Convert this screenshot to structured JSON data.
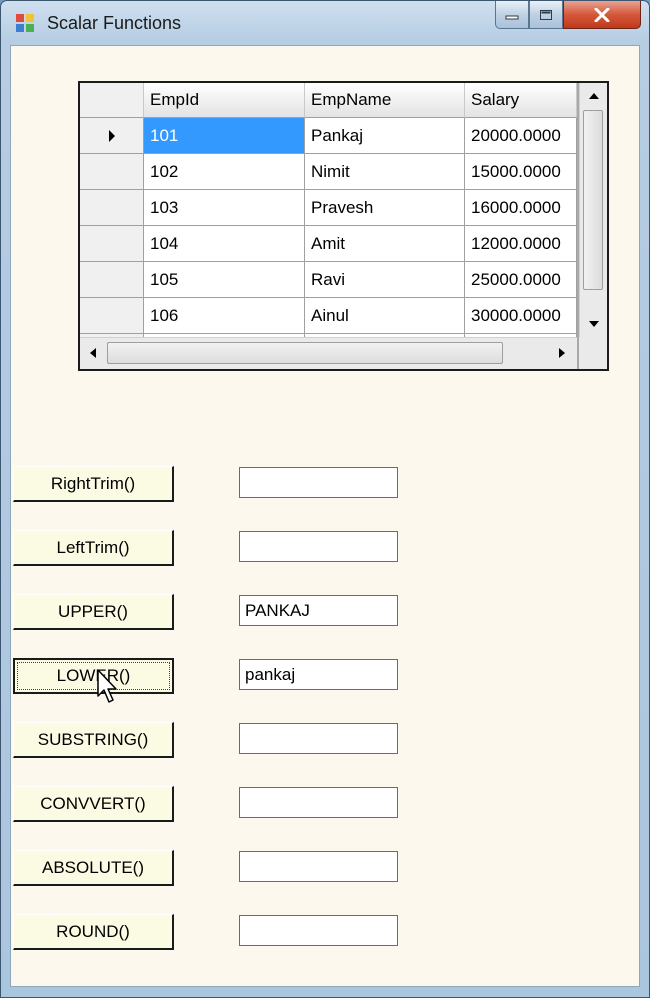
{
  "window": {
    "title": "Scalar Functions",
    "icon": "forms-app-icon"
  },
  "caption_buttons": [
    "minimize-icon",
    "maximize-icon",
    "close-icon"
  ],
  "grid": {
    "columns": [
      "EmpId",
      "EmpName",
      "Salary"
    ],
    "rows": [
      {
        "id": "101",
        "name": "Pankaj",
        "salary": "20000.0000"
      },
      {
        "id": "102",
        "name": "Nimit",
        "salary": "15000.0000"
      },
      {
        "id": "103",
        "name": "Pravesh",
        "salary": "16000.0000"
      },
      {
        "id": "104",
        "name": "Amit",
        "salary": "12000.0000"
      },
      {
        "id": "105",
        "name": "Ravi",
        "salary": "25000.0000"
      },
      {
        "id": "106",
        "name": "Ainul",
        "salary": "30000.0000"
      }
    ],
    "selected_row": 0
  },
  "functions": [
    {
      "label": "RightTrim()",
      "result": ""
    },
    {
      "label": "LeftTrim()",
      "result": ""
    },
    {
      "label": "UPPER()",
      "result": "PANKAJ"
    },
    {
      "label": "LOWER()",
      "result": "pankaj"
    },
    {
      "label": "SUBSTRING()",
      "result": ""
    },
    {
      "label": "CONVVERT()",
      "result": ""
    },
    {
      "label": "ABSOLUTE()",
      "result": ""
    },
    {
      "label": "ROUND()",
      "result": ""
    }
  ],
  "colors": {
    "selection": "#3399ff",
    "client_bg": "#fcf8ee",
    "button_bg": "#fbfae2",
    "close_red": "#c0391c"
  }
}
